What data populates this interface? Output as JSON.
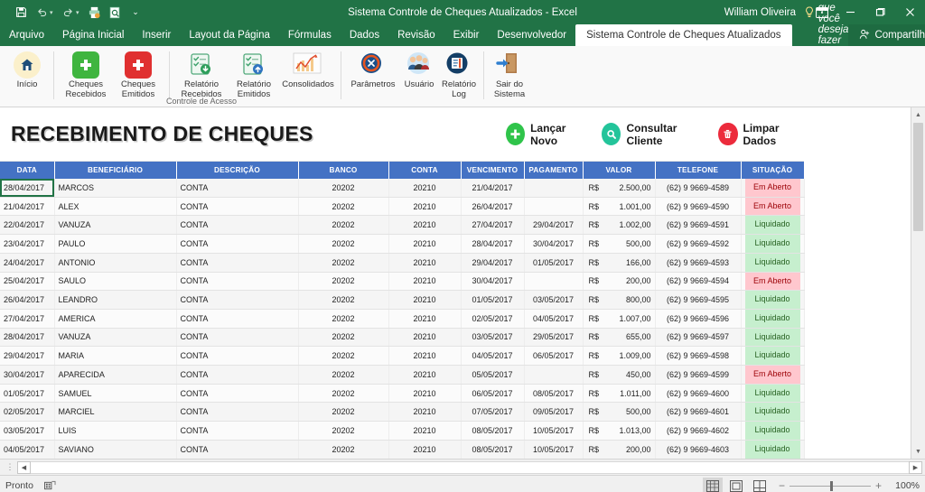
{
  "titlebar": {
    "title": "Sistema Controle de Cheques Atualizados  -  Excel",
    "user": "William Oliveira",
    "qat": [
      {
        "name": "save-icon",
        "glyph": "⬜"
      },
      {
        "name": "undo-icon",
        "glyph": "↶"
      },
      {
        "name": "redo-icon",
        "glyph": "↷"
      },
      {
        "name": "quick-print-icon",
        "glyph": "⎙"
      },
      {
        "name": "print-preview-icon",
        "glyph": "⌗"
      },
      {
        "name": "customize-qat-icon",
        "glyph": "▾"
      }
    ],
    "ribbon_display_icon": "▣",
    "minimize": "─",
    "restore": "❐",
    "close": "✕"
  },
  "tabs": [
    {
      "label": "Arquivo",
      "active": false
    },
    {
      "label": "Página Inicial",
      "active": false
    },
    {
      "label": "Inserir",
      "active": false
    },
    {
      "label": "Layout da Página",
      "active": false
    },
    {
      "label": "Fórmulas",
      "active": false
    },
    {
      "label": "Dados",
      "active": false
    },
    {
      "label": "Revisão",
      "active": false
    },
    {
      "label": "Exibir",
      "active": false
    },
    {
      "label": "Desenvolvedor",
      "active": false
    },
    {
      "label": "Sistema Controle de Cheques Atualizados",
      "active": true
    }
  ],
  "tellme": {
    "label": "Diga-me o que você deseja fazer",
    "icon": "Ὂ1"
  },
  "share": {
    "label": "Compartilhar",
    "icon": "person-add-icon"
  },
  "ribbon": {
    "group_caption": "Controle de Acesso",
    "buttons": [
      {
        "label": "Início",
        "icon": "home-icon"
      },
      {
        "label": "Cheques Recebidos",
        "icon": "plus-green-icon"
      },
      {
        "label": "Cheques Emitidos",
        "icon": "cross-red-icon"
      },
      {
        "label": "Relatório Recebidos",
        "icon": "report-down-icon"
      },
      {
        "label": "Relatório Emitidos",
        "icon": "report-up-icon"
      },
      {
        "label": "Consolidados",
        "icon": "chart-icon"
      },
      {
        "label": "Parâmetros",
        "icon": "settings-icon"
      },
      {
        "label": "Usuário",
        "icon": "users-icon"
      },
      {
        "label": "Relatório Log",
        "icon": "log-icon"
      },
      {
        "label": "Sair do Sistema",
        "icon": "exit-door-icon"
      }
    ]
  },
  "banner": {
    "title": "RECEBIMENTO DE CHEQUES",
    "actions": [
      {
        "label": "Lançar Novo",
        "icon": "plus-circle-icon",
        "color": "#2fc44a",
        "glyph": "+"
      },
      {
        "label": "Consultar Cliente",
        "icon": "search-circle-icon",
        "color": "#23c49a",
        "glyph": "⌕"
      },
      {
        "label": "Limpar Dados",
        "icon": "trash-circle-icon",
        "color": "#ec2b3c",
        "glyph": "🗑"
      }
    ]
  },
  "table": {
    "headers": [
      "DATA",
      "BENEFICIÁRIO",
      "DESCRIÇÃO",
      "BANCO",
      "CONTA",
      "VENCIMENTO",
      "PAGAMENTO",
      "VALOR",
      "TELEFONE",
      "SITUAÇÃO"
    ],
    "currency": "R$",
    "rows": [
      {
        "data": "28/04/2017",
        "beneficiario": "MARCOS",
        "descricao": "CONTA",
        "banco": "20202",
        "conta": "20210",
        "vencimento": "21/04/2017",
        "pagamento": "",
        "valor": "2.500,00",
        "telefone": "(62) 9 9669-4589",
        "situacao": "Em Aberto"
      },
      {
        "data": "21/04/2017",
        "beneficiario": "ALEX",
        "descricao": "CONTA",
        "banco": "20202",
        "conta": "20210",
        "vencimento": "26/04/2017",
        "pagamento": "",
        "valor": "1.001,00",
        "telefone": "(62) 9 9669-4590",
        "situacao": "Em Aberto"
      },
      {
        "data": "22/04/2017",
        "beneficiario": "VANUZA",
        "descricao": "CONTA",
        "banco": "20202",
        "conta": "20210",
        "vencimento": "27/04/2017",
        "pagamento": "29/04/2017",
        "valor": "1.002,00",
        "telefone": "(62) 9 9669-4591",
        "situacao": "Liquidado"
      },
      {
        "data": "23/04/2017",
        "beneficiario": "PAULO",
        "descricao": "CONTA",
        "banco": "20202",
        "conta": "20210",
        "vencimento": "28/04/2017",
        "pagamento": "30/04/2017",
        "valor": "500,00",
        "telefone": "(62) 9 9669-4592",
        "situacao": "Liquidado"
      },
      {
        "data": "24/04/2017",
        "beneficiario": "ANTONIO",
        "descricao": "CONTA",
        "banco": "20202",
        "conta": "20210",
        "vencimento": "29/04/2017",
        "pagamento": "01/05/2017",
        "valor": "166,00",
        "telefone": "(62) 9 9669-4593",
        "situacao": "Liquidado"
      },
      {
        "data": "25/04/2017",
        "beneficiario": "SAULO",
        "descricao": "CONTA",
        "banco": "20202",
        "conta": "20210",
        "vencimento": "30/04/2017",
        "pagamento": "",
        "valor": "200,00",
        "telefone": "(62) 9 9669-4594",
        "situacao": "Em Aberto"
      },
      {
        "data": "26/04/2017",
        "beneficiario": "LEANDRO",
        "descricao": "CONTA",
        "banco": "20202",
        "conta": "20210",
        "vencimento": "01/05/2017",
        "pagamento": "03/05/2017",
        "valor": "800,00",
        "telefone": "(62) 9 9669-4595",
        "situacao": "Liquidado"
      },
      {
        "data": "27/04/2017",
        "beneficiario": "AMERICA",
        "descricao": "CONTA",
        "banco": "20202",
        "conta": "20210",
        "vencimento": "02/05/2017",
        "pagamento": "04/05/2017",
        "valor": "1.007,00",
        "telefone": "(62) 9 9669-4596",
        "situacao": "Liquidado"
      },
      {
        "data": "28/04/2017",
        "beneficiario": "VANUZA",
        "descricao": "CONTA",
        "banco": "20202",
        "conta": "20210",
        "vencimento": "03/05/2017",
        "pagamento": "29/05/2017",
        "valor": "655,00",
        "telefone": "(62) 9 9669-4597",
        "situacao": "Liquidado"
      },
      {
        "data": "29/04/2017",
        "beneficiario": "MARIA",
        "descricao": "CONTA",
        "banco": "20202",
        "conta": "20210",
        "vencimento": "04/05/2017",
        "pagamento": "06/05/2017",
        "valor": "1.009,00",
        "telefone": "(62) 9 9669-4598",
        "situacao": "Liquidado"
      },
      {
        "data": "30/04/2017",
        "beneficiario": "APARECIDA",
        "descricao": "CONTA",
        "banco": "20202",
        "conta": "20210",
        "vencimento": "05/05/2017",
        "pagamento": "",
        "valor": "450,00",
        "telefone": "(62) 9 9669-4599",
        "situacao": "Em Aberto"
      },
      {
        "data": "01/05/2017",
        "beneficiario": "SAMUEL",
        "descricao": "CONTA",
        "banco": "20202",
        "conta": "20210",
        "vencimento": "06/05/2017",
        "pagamento": "08/05/2017",
        "valor": "1.011,00",
        "telefone": "(62) 9 9669-4600",
        "situacao": "Liquidado"
      },
      {
        "data": "02/05/2017",
        "beneficiario": "MARCIEL",
        "descricao": "CONTA",
        "banco": "20202",
        "conta": "20210",
        "vencimento": "07/05/2017",
        "pagamento": "09/05/2017",
        "valor": "500,00",
        "telefone": "(62) 9 9669-4601",
        "situacao": "Liquidado"
      },
      {
        "data": "03/05/2017",
        "beneficiario": "LUIS",
        "descricao": "CONTA",
        "banco": "20202",
        "conta": "20210",
        "vencimento": "08/05/2017",
        "pagamento": "10/05/2017",
        "valor": "1.013,00",
        "telefone": "(62) 9 9669-4602",
        "situacao": "Liquidado"
      },
      {
        "data": "04/05/2017",
        "beneficiario": "SAVIANO",
        "descricao": "CONTA",
        "banco": "20202",
        "conta": "20210",
        "vencimento": "08/05/2017",
        "pagamento": "10/05/2017",
        "valor": "200,00",
        "telefone": "(62) 9 9669-4603",
        "situacao": "Liquidado"
      }
    ]
  },
  "statusbar": {
    "mode": "Pronto",
    "zoom": "100%",
    "views": [
      {
        "name": "normal-view-icon",
        "active": true
      },
      {
        "name": "page-layout-view-icon",
        "active": false
      },
      {
        "name": "page-break-view-icon",
        "active": false
      }
    ],
    "zoom_out": "−",
    "zoom_in": "+"
  },
  "colors": {
    "excel_green": "#217346",
    "header_blue": "#4472c4",
    "status_open_bg": "#ffc7ce",
    "status_open_fg": "#9c0006",
    "status_ok_bg": "#c6efce",
    "status_ok_fg": "#276221"
  }
}
